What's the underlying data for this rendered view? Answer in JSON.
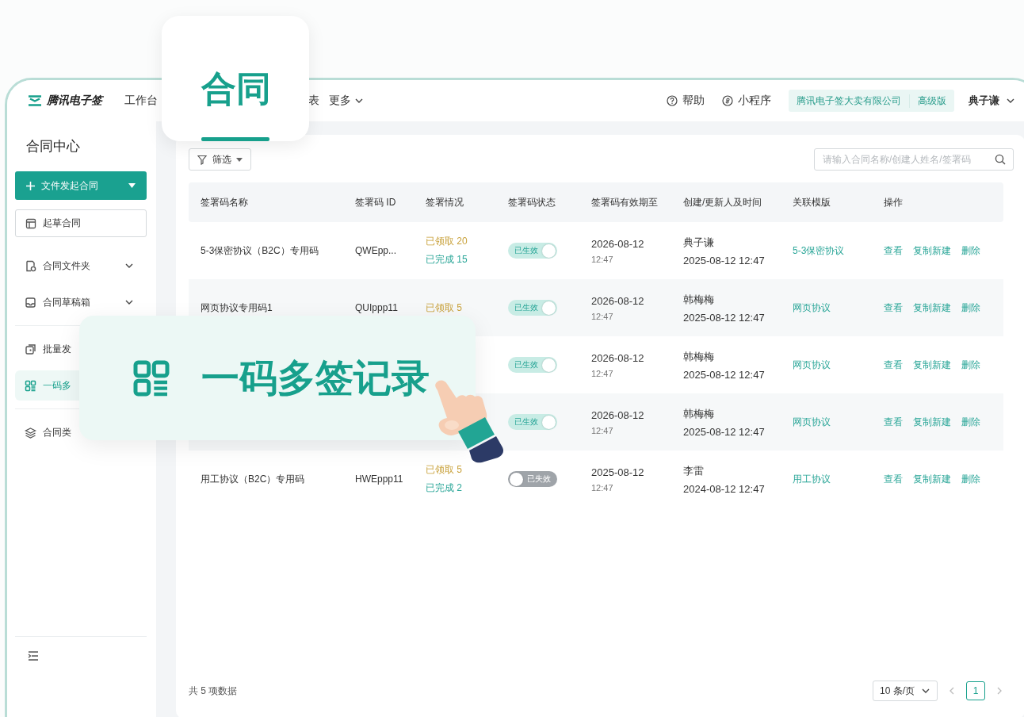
{
  "header": {
    "logo": "腾讯电子签",
    "nav": [
      {
        "label": "工作台",
        "kind": "plain"
      },
      {
        "label": "表",
        "kind": "plain"
      },
      {
        "label": "更多",
        "kind": "dropdown"
      }
    ],
    "help": "帮助",
    "miniapp": "小程序",
    "company": "腾讯电子签大卖有限公司",
    "plan": "高级版",
    "user": "典子谦"
  },
  "active_tab": {
    "label": "合同"
  },
  "sidebar": {
    "title": "合同中心",
    "primary_button": "文件发起合同",
    "draft_button": "起草合同",
    "items": [
      {
        "label": "合同文件夹",
        "kind": "folder",
        "expandable": true,
        "selected": false
      },
      {
        "label": "合同草稿箱",
        "kind": "drafts",
        "expandable": true,
        "selected": false
      },
      {
        "label": "批量发",
        "kind": "batch",
        "selected": false
      },
      {
        "label": "一码多",
        "kind": "qr",
        "selected": true
      },
      {
        "label": "合同类",
        "kind": "types",
        "selected": false
      }
    ]
  },
  "toolbar": {
    "filter": "筛选",
    "search_placeholder": "请输入合同名称/创建人姓名/签署码"
  },
  "table": {
    "columns": [
      "签署码名称",
      "签署码 ID",
      "签署情况",
      "签署码状态",
      "签署码有效期至",
      "创建/更新人及时间",
      "关联模版",
      "操作"
    ],
    "rows": [
      {
        "name": "5-3保密协议（B2C）专用码",
        "id": "QWEpp...",
        "claimed": "已领取 20",
        "completed": "已完成 15",
        "status": "已生效",
        "active": true,
        "expiry_date": "2026-08-12",
        "expiry_time": "12:47",
        "creator": "典子谦",
        "updated": "2025-08-12 12:47",
        "template": "5-3保密协议",
        "actions": [
          "查看",
          "复制新建",
          "删除"
        ]
      },
      {
        "name": "网页协议专用码1",
        "id": "QUIppp11",
        "claimed": "已领取 5",
        "status": "已生效",
        "active": true,
        "expiry_date": "2026-08-12",
        "expiry_time": "12:47",
        "creator": "韩梅梅",
        "updated": "2025-08-12 12:47",
        "template": "网页协议",
        "actions": [
          "查看",
          "复制新建",
          "删除"
        ]
      },
      {
        "status": "已生效",
        "active": true,
        "expiry_date": "2026-08-12",
        "expiry_time": "12:47",
        "creator": "韩梅梅",
        "updated": "2025-08-12 12:47",
        "template": "网页协议",
        "actions": [
          "查看",
          "复制新建",
          "删除"
        ]
      },
      {
        "status": "已生效",
        "active": true,
        "expiry_date": "2026-08-12",
        "expiry_time": "12:47",
        "creator": "韩梅梅",
        "updated": "2025-08-12 12:47",
        "template": "网页协议",
        "actions": [
          "查看",
          "复制新建",
          "删除"
        ]
      },
      {
        "name": "用工协议（B2C）专用码",
        "id": "HWEppp11",
        "claimed": "已领取 5",
        "completed": "已完成 2",
        "status": "已失效",
        "active": false,
        "expiry_date": "2025-08-12",
        "expiry_time": "12:47",
        "creator": "李雷",
        "updated": "2024-08-12 12:47",
        "template": "用工协议",
        "actions": [
          "查看",
          "复制新建",
          "删除"
        ]
      }
    ]
  },
  "footer": {
    "total": "共 5 项数据",
    "page_size": "10 条/页",
    "page": "1"
  },
  "callout": {
    "label": "一码多签记录"
  }
}
